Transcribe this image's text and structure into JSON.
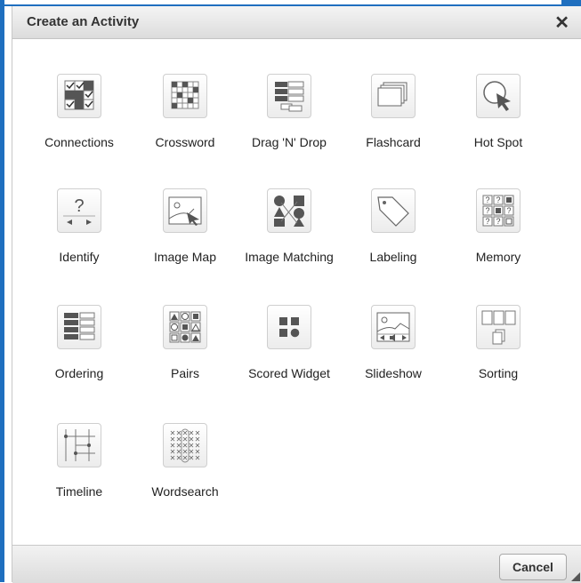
{
  "dialog": {
    "title": "Create an Activity",
    "close_icon": "close-icon",
    "cancel_label": "Cancel"
  },
  "activities": [
    {
      "label": "Connections",
      "icon": "connections-icon"
    },
    {
      "label": "Crossword",
      "icon": "crossword-icon"
    },
    {
      "label": "Drag 'N' Drop",
      "icon": "drag-n-drop-icon"
    },
    {
      "label": "Flashcard",
      "icon": "flashcard-icon"
    },
    {
      "label": "Hot Spot",
      "icon": "hot-spot-icon"
    },
    {
      "label": "Identify",
      "icon": "identify-icon"
    },
    {
      "label": "Image Map",
      "icon": "image-map-icon"
    },
    {
      "label": "Image Matching",
      "icon": "image-matching-icon"
    },
    {
      "label": "Labeling",
      "icon": "labeling-icon"
    },
    {
      "label": "Memory",
      "icon": "memory-icon"
    },
    {
      "label": "Ordering",
      "icon": "ordering-icon"
    },
    {
      "label": "Pairs",
      "icon": "pairs-icon"
    },
    {
      "label": "Scored Widget",
      "icon": "scored-widget-icon"
    },
    {
      "label": "Slideshow",
      "icon": "slideshow-icon"
    },
    {
      "label": "Sorting",
      "icon": "sorting-icon"
    },
    {
      "label": "Timeline",
      "icon": "timeline-icon"
    },
    {
      "label": "Wordsearch",
      "icon": "wordsearch-icon"
    }
  ],
  "colors": {
    "accent": "#1f6fbf",
    "icon_fill": "#555555"
  }
}
